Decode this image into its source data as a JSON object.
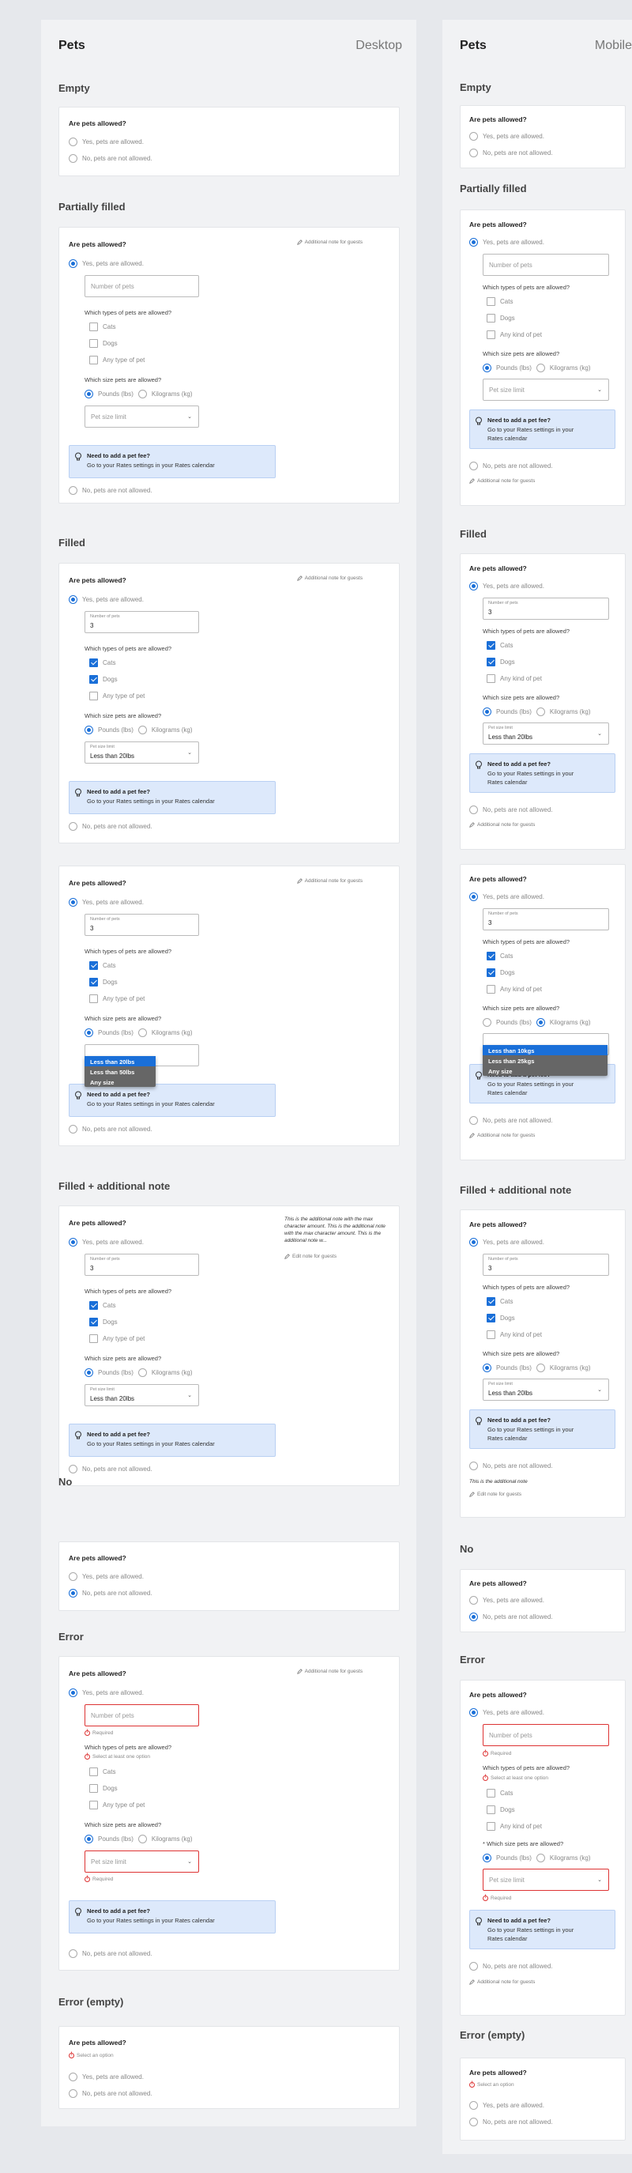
{
  "headers": {
    "title": "Pets",
    "desktop": "Desktop",
    "mobile": "Mobile"
  },
  "sections": {
    "empty": "Empty",
    "partial": "Partially filled",
    "filled": "Filled",
    "filled_note": "Filled + additional note",
    "no": "No",
    "error": "Error",
    "error_empty": "Error (empty)"
  },
  "q": "Are pets allowed?",
  "yes": "Yes, pets are allowed.",
  "no": "No, pets are not allowed.",
  "num_placeholder": "Number of pets",
  "num_label": "Number of pets",
  "num_value": "3",
  "types_q": "Which types of pets are allowed?",
  "types": {
    "cats": "Cats",
    "dogs": "Dogs",
    "any": "Any type of pet",
    "any_m": "Any kind of pet"
  },
  "size_q": "Which size pets are allowed?",
  "size_q_req": "* Which size pets are allowed?",
  "units": {
    "lbs": "Pounds (lbs)",
    "kg": "Kilograms (kg)"
  },
  "limit_placeholder": "Pet size limit",
  "limit_label": "Pet size limit",
  "limit_value": "Less than 20lbs",
  "dropdown_lbs": [
    "Less than 20lbs",
    "Less than 50lbs",
    "Any size"
  ],
  "dropdown_kg": [
    "Less than 10kgs",
    "Less than 25kgs",
    "Any size"
  ],
  "fee_title": "Need to add a pet fee?",
  "fee_desc": "Go to your Rates settings in your Rates calendar",
  "fee_desc_m1": "Go to your Rates settings in your",
  "fee_desc_m2": "Rates calendar",
  "note_add": "Additional note for guests",
  "note_edit": "Edit note for guests",
  "note_text": "This is the additional note with the max character amount. This is the additional note with the max character amount. This is the additional note w...",
  "note_text_m": "This is the additional note",
  "req": "Required",
  "sel_one": "Select at least one option",
  "sel_opt": "Select an option"
}
